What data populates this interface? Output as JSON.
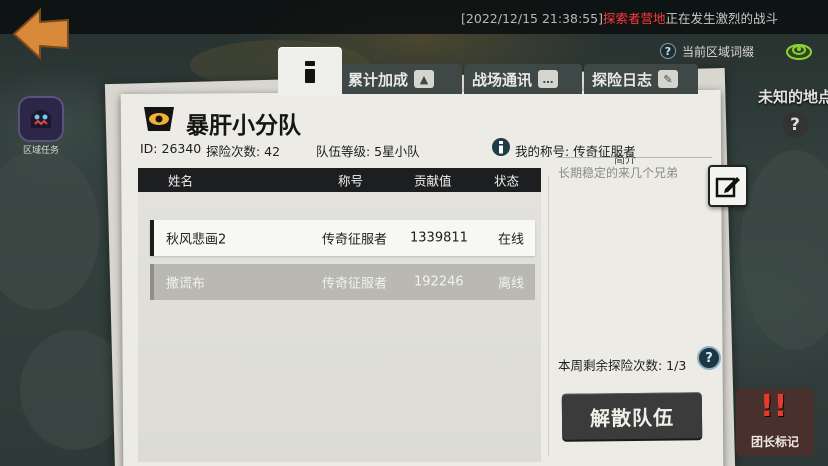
{
  "broadcast": {
    "time": "[2022/12/15 21:38:55]",
    "place": "探索者营地",
    "message": "正在发生激烈的战斗"
  },
  "region": {
    "glossary_label": "当前区域词缀",
    "unknown_label": "未知的地点",
    "task_label": "区域任务"
  },
  "tabs": {
    "accumulate": "累计加成",
    "battle_report": "战场通讯",
    "explore_log": "探险日志"
  },
  "team": {
    "name": "暴肝小分队",
    "id_text": "ID: 26340",
    "explore_count_text": "探险次数: 42",
    "level_text": "队伍等级: 5星小队",
    "my_title_text": "我的称号: 传奇征服者"
  },
  "intro": {
    "heading": "简介",
    "text": "长期稳定的来几个兄弟"
  },
  "table": {
    "headers": [
      "姓名",
      "称号",
      "贡献值",
      "状态"
    ],
    "rows": [
      {
        "name": "秋风悲画2",
        "title": "传奇征服者",
        "contribution": "1339811",
        "status": "在线"
      },
      {
        "name": "撒谎布",
        "title": "传奇征服者",
        "contribution": "192246",
        "status": "离线"
      }
    ]
  },
  "weekly": {
    "text": "本周剩余探险次数:  1/3"
  },
  "buttons": {
    "disband": "解散队伍",
    "leader_mark": "团长标记"
  },
  "colors": {
    "alert_red": "#ff3a3a",
    "panel_bg": "#ecebe6",
    "back_arrow": "#d9893a"
  },
  "icons": {
    "back": "back-arrow-icon",
    "eye": "eye-icon",
    "edit": "edit-pencil-icon",
    "help": "question-icon",
    "radar": "radar-icon"
  }
}
